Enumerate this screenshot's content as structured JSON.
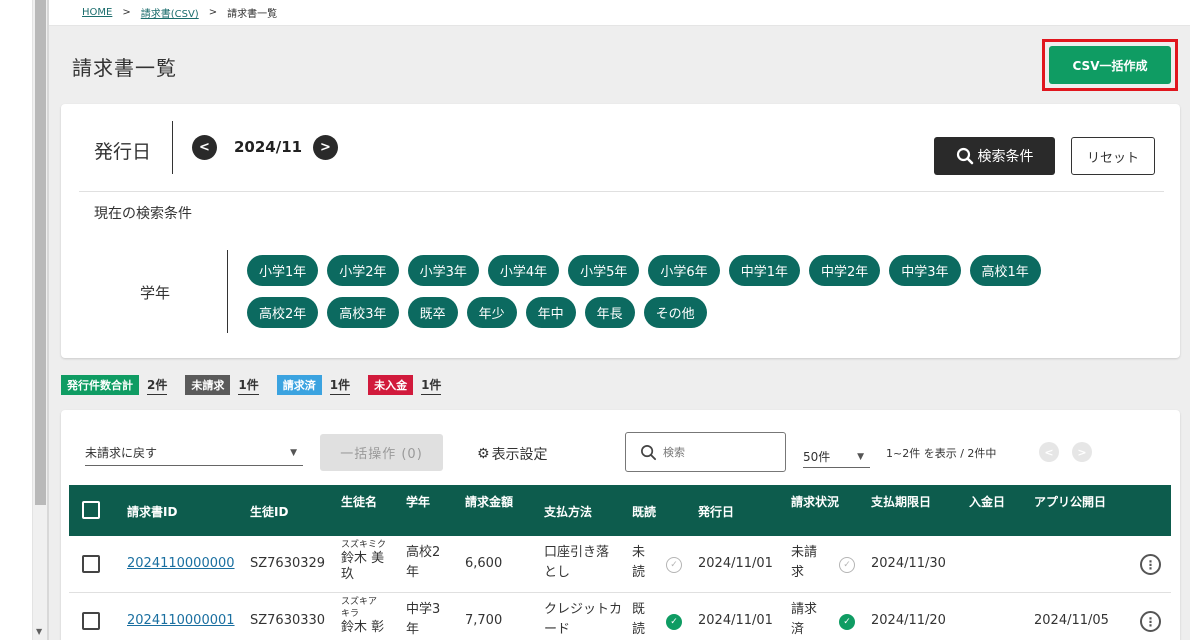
{
  "breadcrumb": {
    "home": "HOME",
    "csv": "請求書(CSV)",
    "current": "請求書一覧",
    "sep": ">"
  },
  "page": {
    "title": "請求書一覧",
    "csv_button": "CSV一括作成"
  },
  "filter": {
    "issue_label": "発行日",
    "month": "2024/11",
    "prev_icon": "chevron-left-icon",
    "next_icon": "chevron-right-icon",
    "search_button": "検索条件",
    "reset_button": "リセット",
    "current_conditions": "現在の検索条件",
    "grade_label": "学年",
    "grades": [
      "小学1年",
      "小学2年",
      "小学3年",
      "小学4年",
      "小学5年",
      "小学6年",
      "中学1年",
      "中学2年",
      "中学3年",
      "高校1年",
      "高校2年",
      "高校3年",
      "既卒",
      "年少",
      "年中",
      "年長",
      "その他"
    ]
  },
  "stats": [
    {
      "label": "発行件数合計",
      "count": "2件",
      "color": "#0f9c63"
    },
    {
      "label": "未請求",
      "count": "1件",
      "color": "#5a5a5a"
    },
    {
      "label": "請求済",
      "count": "1件",
      "color": "#3ba3e0"
    },
    {
      "label": "未入金",
      "count": "1件",
      "color": "#d11a3c"
    }
  ],
  "toolbar": {
    "action_select": "未請求に戻す",
    "bulk_button": "一括操作 (0)",
    "display_setting": "表示設定",
    "search_placeholder": "検索",
    "per_page": "50件",
    "range_text": "1~2件 を表示 / 2件中"
  },
  "table": {
    "headers": {
      "invoice_id": "請求書ID",
      "student_id": "生徒ID",
      "student_name": "生徒名",
      "grade": "学年",
      "amount": "請求金額",
      "payment_method": "支払方法",
      "read": "既読",
      "issue_date": "発行日",
      "status": "請求状況",
      "due_date": "支払期限日",
      "deposit_date": "入金日",
      "app_date": "アプリ公開日"
    },
    "rows": [
      {
        "invoice_id": "2024110000000",
        "student_id": "SZ7630329",
        "furigana": "スズキミク",
        "name_1": "鈴木 美",
        "name_2": "玖",
        "grade_1": "高校2",
        "grade_2": "年",
        "amount": "6,600",
        "pay_1": "口座引き落",
        "pay_2": "とし",
        "read_1": "未",
        "read_2": "読",
        "read_icon": "check-circle-outline-icon",
        "issue_date": "2024/11/01",
        "status_1": "未請",
        "status_2": "求",
        "status_icon": "check-circle-outline-icon",
        "due_date": "2024/11/30",
        "deposit_date": "",
        "app_date": ""
      },
      {
        "invoice_id": "2024110000001",
        "student_id": "SZ7630330",
        "furigana": "スズキア",
        "furigana_2": "キラ",
        "name_1": "鈴木 彰",
        "grade_1": "中学3",
        "grade_2": "年",
        "amount": "7,700",
        "pay_1": "クレジットカ",
        "pay_2": "ード",
        "read_1": "既",
        "read_2": "読",
        "read_icon": "check-circle-filled-icon",
        "issue_date": "2024/11/01",
        "status_1": "請求",
        "status_2": "済",
        "status_icon": "check-circle-filled-icon",
        "due_date": "2024/11/20",
        "deposit_date": "",
        "app_date": "2024/11/05"
      }
    ]
  }
}
